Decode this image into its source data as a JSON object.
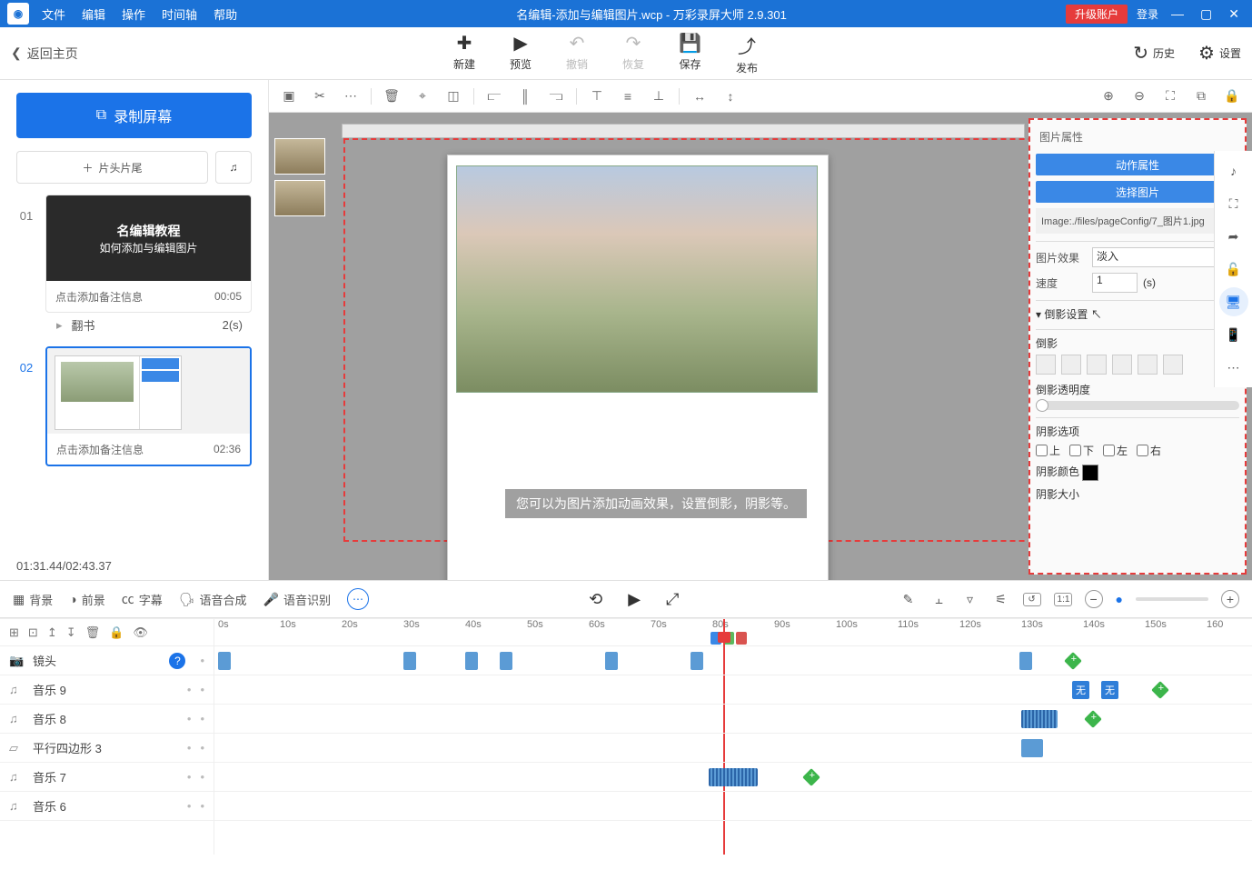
{
  "titlebar": {
    "menu": [
      "文件",
      "编辑",
      "操作",
      "时间轴",
      "帮助"
    ],
    "title": "名编辑-添加与编辑图片.wcp - 万彩录屏大师 2.9.301",
    "upgrade": "升级账户",
    "login": "登录"
  },
  "toolbar1": {
    "back": "返回主页",
    "new": "新建",
    "preview": "预览",
    "undo": "撤销",
    "redo": "恢复",
    "save": "保存",
    "publish": "发布",
    "history": "历史",
    "settings": "设置"
  },
  "sidebar": {
    "record": "录制屏幕",
    "addclip": "片头片尾",
    "trans_label": "翻书",
    "trans_dur": "2(s)",
    "scene1": {
      "num": "01",
      "line1": "名编辑教程",
      "line2": "如何添加与编辑图片",
      "note": "点击添加备注信息",
      "time": "00:05"
    },
    "scene2": {
      "num": "02",
      "note": "点击添加备注信息",
      "time": "02:36"
    },
    "timecode": "01:31.44/02:43.37"
  },
  "canvas": {
    "overlay": "您可以为图片添加动画效果，设置倒影，阴影等。",
    "panel": {
      "title": "图片属性",
      "btn_anim": "动作属性",
      "btn_select": "选择图片",
      "path": "Image:./files/pageConfig/7_图片1.jpg",
      "effect_label": "图片效果",
      "effect_value": "淡入",
      "speed_label": "速度",
      "speed_value": "1",
      "speed_unit": "(s)",
      "reflection_section": "倒影设置",
      "reflection": "倒影",
      "reflection_opacity": "倒影透明度",
      "shadow_section": "阴影选项",
      "chk_up": "上",
      "chk_down": "下",
      "chk_left": "左",
      "chk_right": "右",
      "shadow_color": "阴影颜色",
      "shadow_size": "阴影大小"
    }
  },
  "timeline_tabs": {
    "bg": "背景",
    "fg": "前景",
    "sub": "字幕",
    "tts": "语音合成",
    "asr": "语音识别"
  },
  "tracks": {
    "camera": "镜头",
    "music9": "音乐 9",
    "music8": "音乐 8",
    "shape3": "平行四边形 3",
    "music7": "音乐 7",
    "music6": "音乐 6"
  },
  "ruler_labels": [
    "0s",
    "10s",
    "20s",
    "30s",
    "40s",
    "50s",
    "60s",
    "70s",
    "80s",
    "90s",
    "100s",
    "110s",
    "120s",
    "130s",
    "140s",
    "150s",
    "160"
  ],
  "clip_badges": {
    "none1": "无",
    "none2": "无"
  }
}
